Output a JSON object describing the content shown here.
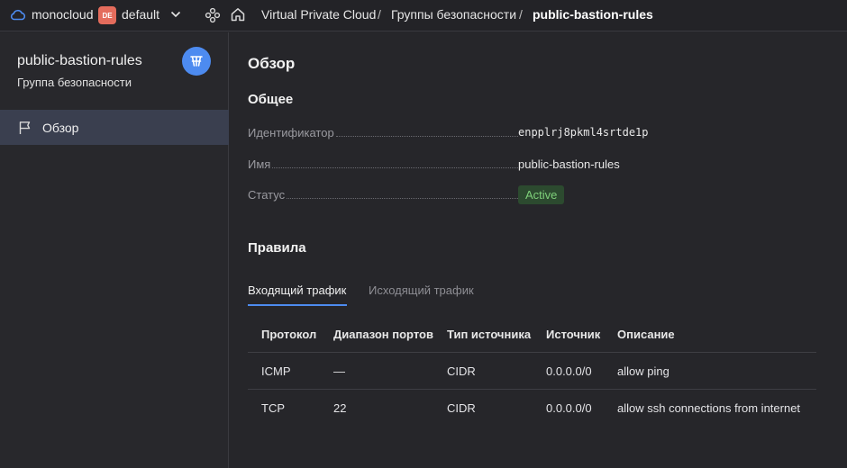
{
  "topbar": {
    "org": "monocloud",
    "folder_badge": "DE",
    "folder": "default",
    "breadcrumbs": [
      "Virtual Private Cloud",
      "Группы безопасности",
      "public-bastion-rules"
    ],
    "separator": "/"
  },
  "sidebar": {
    "title": "public-bastion-rules",
    "subtitle": "Группа безопасности",
    "items": [
      {
        "label": "Обзор",
        "icon": "flag-icon",
        "active": true
      }
    ]
  },
  "main": {
    "title": "Обзор",
    "general": {
      "heading": "Общее",
      "fields": [
        {
          "label": "Идентификатор",
          "value": "enpplrj8pkml4srtde1p"
        },
        {
          "label": "Имя",
          "value": "public-bastion-rules"
        },
        {
          "label": "Статус",
          "value": "Active"
        }
      ]
    },
    "rules": {
      "heading": "Правила",
      "tabs": [
        "Входящий трафик",
        "Исходящий трафик"
      ],
      "active_tab": 0,
      "columns": [
        "Протокол",
        "Диапазон портов",
        "Тип источника",
        "Источник",
        "Описание"
      ],
      "rows": [
        [
          "ICMP",
          "—",
          "CIDR",
          "0.0.0.0/0",
          "allow ping"
        ],
        [
          "TCP",
          "22",
          "CIDR",
          "0.0.0.0/0",
          "allow ssh connections from internet"
        ]
      ]
    }
  },
  "colors": {
    "accent": "#4d8bf0",
    "status_bg": "#2c4a2f",
    "status_text": "#7ed07a",
    "badge": "#e46c5c"
  }
}
